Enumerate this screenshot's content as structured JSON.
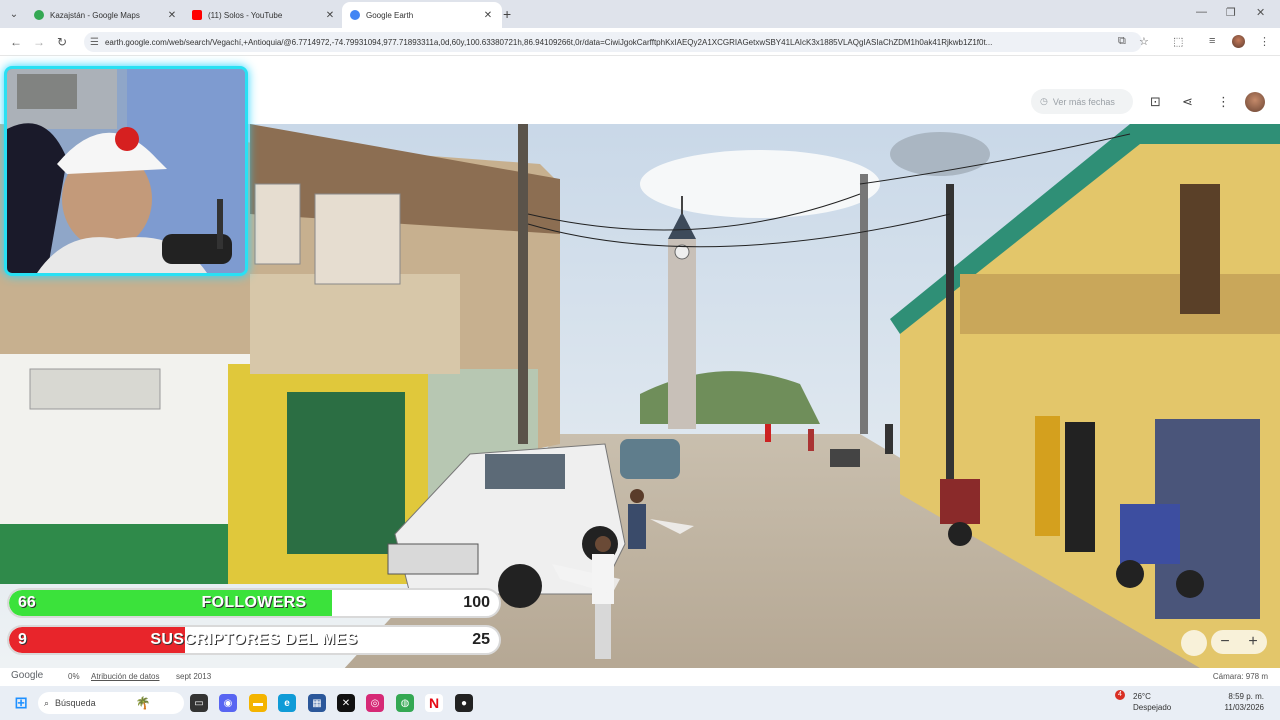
{
  "browser": {
    "tabs": [
      {
        "title": "Kazajstán - Google Maps",
        "icon": "maps-pin-icon",
        "color": "#34a853"
      },
      {
        "title": "(11) Solos - YouTube",
        "icon": "youtube-icon",
        "color": "#ff0000"
      },
      {
        "title": "Google Earth",
        "icon": "earth-icon",
        "color": "#4285f4"
      }
    ],
    "url": "earth.google.com/web/search/Vegachí,+Antioquia/@6.7714972,-74.79931094,977.71893311a,0d,60y,100.63380721h,86.94109266t,0r/data=CiwiJgokCarfftphKxIAEQy2A1XCGRIAGetxwSBY41LAIcK3x1885VLAQgIASIaChZDM1h0ak41Rjkwb1Z1f0t..."
  },
  "earth": {
    "ver_fechas": "Ver más fechas",
    "footer": {
      "brand": "Google",
      "zoom": "0%",
      "attribution": "Atribución de datos",
      "date": "sept 2013",
      "camera": "Cámara: 978 m"
    }
  },
  "stream": {
    "followers": {
      "current": "66",
      "label": "FOLLOWERS",
      "goal": "100",
      "progress": 0.66,
      "color": "#3be23b"
    },
    "subs": {
      "current": "9",
      "label": "SUSCRIPTORES DEL MES",
      "goal": "25",
      "progress": 0.36,
      "color": "#e8252b"
    }
  },
  "taskbar": {
    "search": "Búsqueda",
    "weather_temp": "26°C",
    "weather_desc": "Despejado",
    "weather_badge": "4",
    "time": "8:59 p. m.",
    "date": "11/03/2026"
  }
}
